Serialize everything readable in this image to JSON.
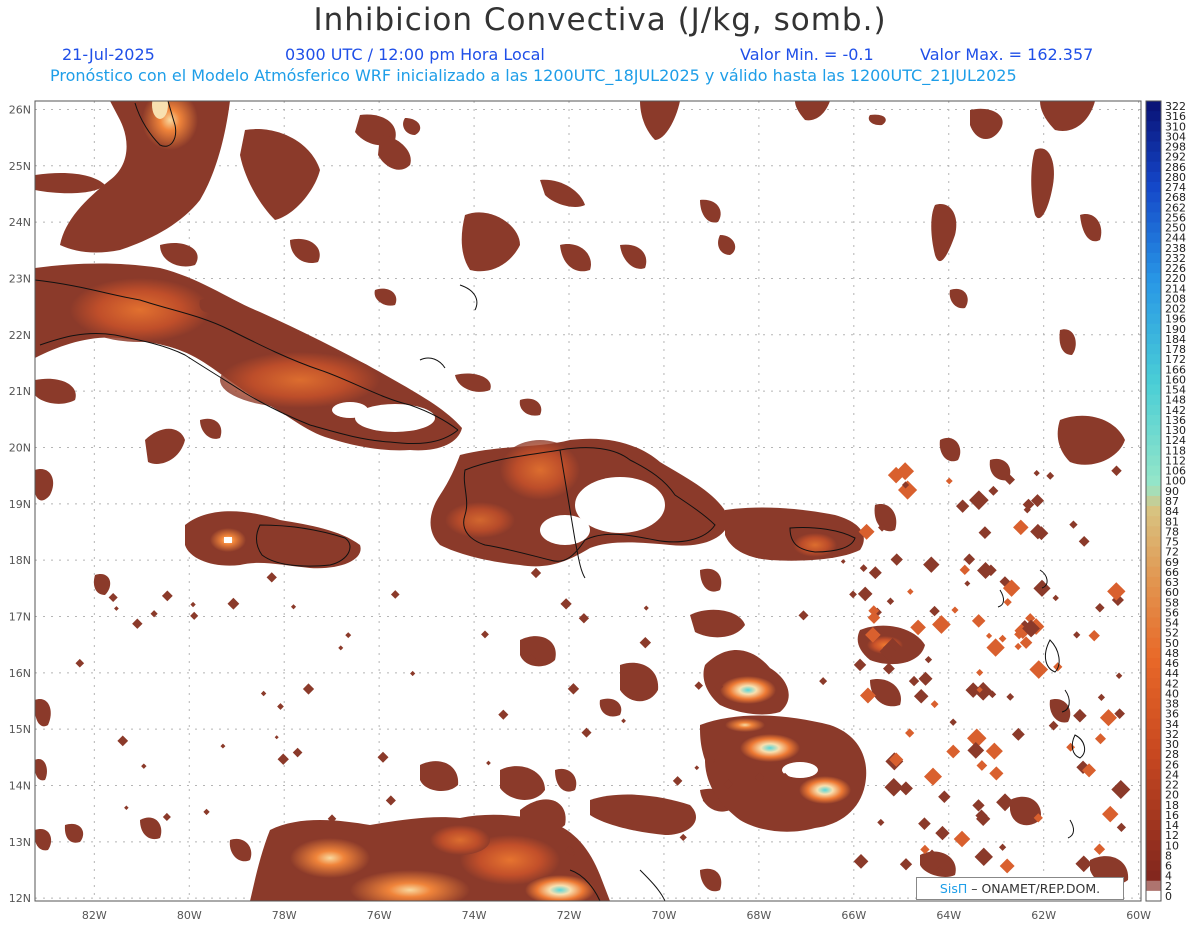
{
  "header": {
    "title": "Inhibicion Convectiva (J/kg, somb.)",
    "date": "21-Jul-2025",
    "time": "0300 UTC / 12:00 pm Hora Local",
    "value_min": "Valor Min. = -0.1",
    "value_max": "Valor Max. = 162.357",
    "forecast_line": "Pronóstico con el Modelo Atmósferico WRF inicializado a las 1200UTC_18JUL2025 y válido hasta las  1200UTC_21JUL2025"
  },
  "credit": {
    "brand": "SisΠ",
    "org": "– ONAMET/REP.DOM."
  },
  "colors": {
    "low": "#8b3a2a",
    "mid": "#e8602a",
    "high": "#f8d9a0",
    "cyan": "#59d6d8",
    "coast": "#111111",
    "grid": "#b5b5b5"
  },
  "map_data": {
    "lat_labels": [
      "26N",
      "25N",
      "24N",
      "23N",
      "22N",
      "21N",
      "20N",
      "19N",
      "18N",
      "17N",
      "16N",
      "15N",
      "14N",
      "13N",
      "12N"
    ],
    "lon_labels": [
      "82W",
      "80W",
      "78W",
      "76W",
      "74W",
      "72W",
      "70W",
      "68W",
      "66W",
      "64W",
      "62W",
      "60W"
    ],
    "lat_values": [
      26,
      25,
      24,
      23,
      22,
      21,
      20,
      19,
      18,
      17,
      16,
      15,
      14,
      13,
      12
    ],
    "lon_values": [
      -82,
      -80,
      -78,
      -76,
      -74,
      -72,
      -70,
      -68,
      -66,
      -64,
      -62,
      -60
    ],
    "lon_range": [
      -83.25,
      -59.95
    ],
    "lat_range": [
      11.95,
      26.15
    ]
  },
  "colorbar": {
    "labels": [
      "322",
      "316",
      "310",
      "304",
      "298",
      "292",
      "286",
      "280",
      "274",
      "268",
      "262",
      "256",
      "250",
      "244",
      "238",
      "232",
      "226",
      "220",
      "214",
      "208",
      "202",
      "196",
      "190",
      "184",
      "178",
      "172",
      "166",
      "160",
      "154",
      "148",
      "142",
      "136",
      "130",
      "124",
      "118",
      "112",
      "106",
      "100",
      "90",
      "87",
      "84",
      "81",
      "78",
      "75",
      "72",
      "69",
      "66",
      "63",
      "60",
      "58",
      "56",
      "54",
      "52",
      "50",
      "48",
      "46",
      "44",
      "42",
      "40",
      "38",
      "36",
      "34",
      "32",
      "30",
      "28",
      "26",
      "24",
      "22",
      "20",
      "18",
      "16",
      "14",
      "12",
      "10",
      "8",
      "6",
      "4",
      "2",
      "0"
    ]
  }
}
